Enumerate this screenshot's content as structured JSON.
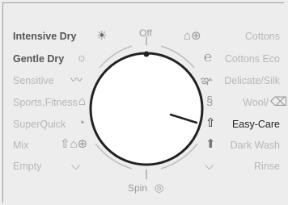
{
  "panel": {
    "off_label": "Off",
    "spin_label": "Spin",
    "selected_program": "Easy-Care"
  },
  "left_programs": [
    {
      "label": "Intensive Dry",
      "icon": "sun-icon",
      "style": "dark"
    },
    {
      "label": "Gentle Dry",
      "icon": "sun-outline-icon",
      "style": "dark"
    },
    {
      "label": "Sensitive",
      "icon": "feather-icon",
      "style": "muted"
    },
    {
      "label": "Sports,Fitness",
      "icon": "shirt-number-icon",
      "style": "muted"
    },
    {
      "label": "SuperQuick",
      "icon": "quick-cycle-icon",
      "style": "muted"
    },
    {
      "label": "Mix",
      "icon": "mixed-clothes-icon",
      "style": "muted"
    },
    {
      "label": "Empty",
      "icon": "tub-empty-icon",
      "style": "muted"
    }
  ],
  "right_programs": [
    {
      "label": "Cottons",
      "icon": "cottons-icon",
      "style": "muted"
    },
    {
      "label": "Cottons Eco",
      "icon": "eco-icon",
      "style": "muted"
    },
    {
      "label": "Delicate/Silk",
      "icon": "butterfly-icon",
      "style": "muted"
    },
    {
      "label": "Wool/",
      "icon": "wool-icon",
      "style": "muted"
    },
    {
      "label": "Easy-Care",
      "icon": "easy-care-shirt-icon",
      "style": "active"
    },
    {
      "label": "Dark Wash",
      "icon": "dark-shirt-icon",
      "style": "muted"
    },
    {
      "label": "Rinse",
      "icon": "rinse-tub-icon",
      "style": "muted"
    }
  ]
}
